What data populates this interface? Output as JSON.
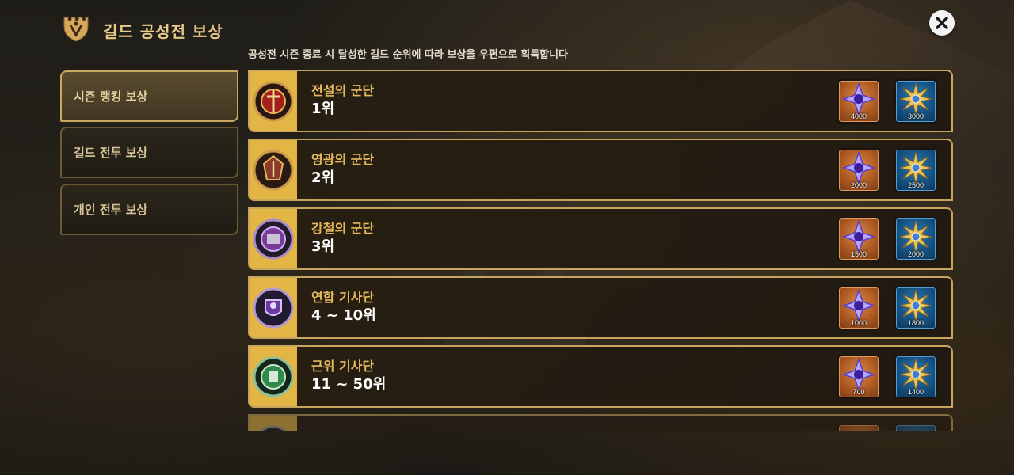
{
  "header": {
    "title": "길드 공성전 보상",
    "subtitle": "공성전 시즌 종료 시 달성한 길드 순위에 따라 보상을 우편으로 획득합니다"
  },
  "tabs": [
    {
      "label": "시즌 랭킹 보상",
      "active": true
    },
    {
      "label": "길드 전투 보상",
      "active": false
    },
    {
      "label": "개인 전투 보상",
      "active": false
    }
  ],
  "rewards": [
    {
      "guild": "전설의 군단",
      "rank": "1위",
      "emblem_color": "#a3201c",
      "gem_qty": "4000",
      "medal_qty": "3000"
    },
    {
      "guild": "영광의 군단",
      "rank": "2위",
      "emblem_color": "#8a3a2a",
      "gem_qty": "2000",
      "medal_qty": "2500"
    },
    {
      "guild": "강철의 군단",
      "rank": "3위",
      "emblem_color": "#7a3a9a",
      "gem_qty": "1500",
      "medal_qty": "2000"
    },
    {
      "guild": "연합 기사단",
      "rank": "4 ~ 10위",
      "emblem_color": "#6b3aa0",
      "gem_qty": "1000",
      "medal_qty": "1800"
    },
    {
      "guild": "근위 기사단",
      "rank": "11 ~ 50위",
      "emblem_color": "#2f8a4a",
      "gem_qty": "700",
      "medal_qty": "1400"
    }
  ],
  "colors": {
    "accent_gold": "#e3b545",
    "title_gold": "#e8c98a",
    "gem_bg": "#a9561f",
    "medal_bg": "#15507f"
  },
  "icons": {
    "title": "guild-castle-icon",
    "close": "close-icon",
    "gem": "purple-star-gem-icon",
    "medal": "gold-medal-icon"
  }
}
